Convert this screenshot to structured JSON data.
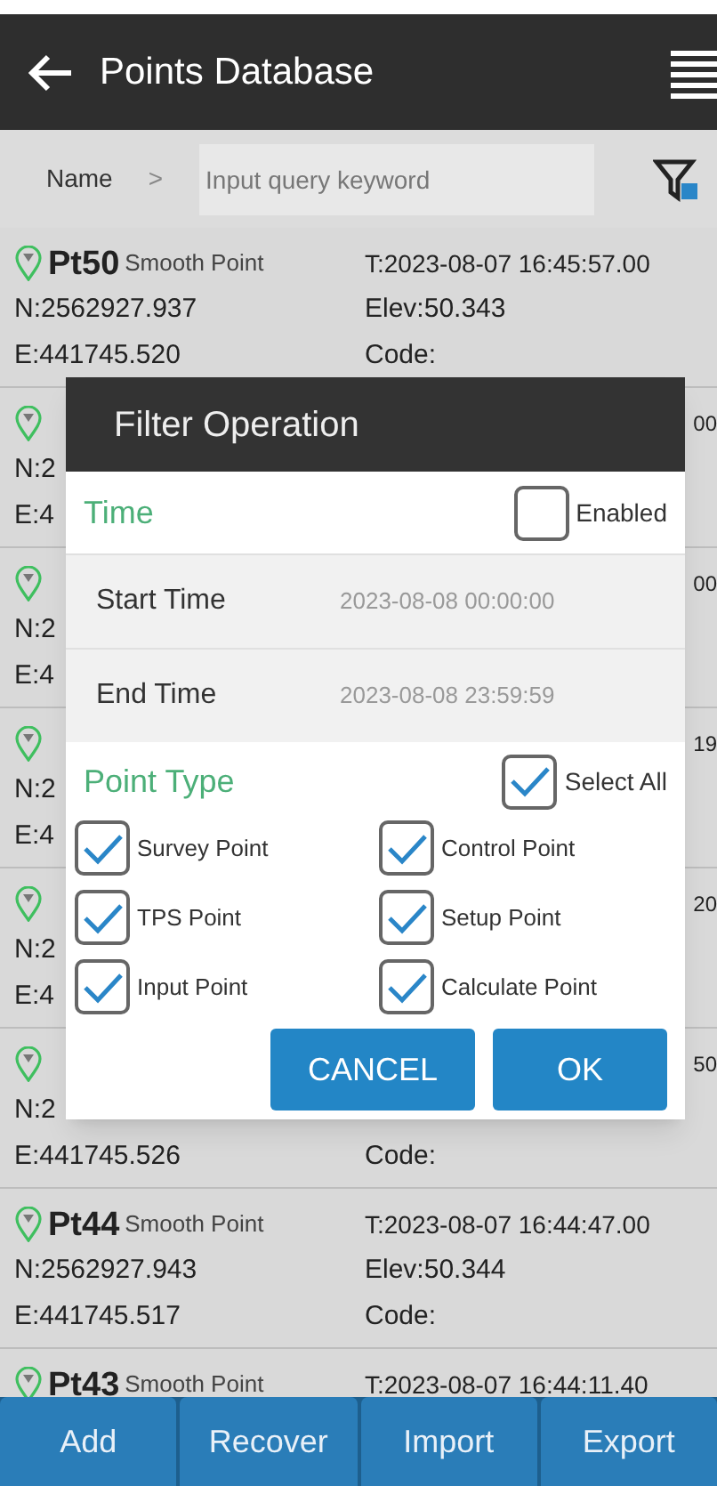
{
  "header": {
    "title": "Points Database"
  },
  "search": {
    "field_label": "Name",
    "separator": ">",
    "placeholder": "Input query keyword"
  },
  "points": [
    {
      "kind": "full",
      "name": "Pt50",
      "type": "Smooth Point",
      "t": "T:2023-08-07 16:45:57.00",
      "n": "N:2562927.937",
      "elev": "Elev:50.343",
      "e": "E:441745.520",
      "code": "Code:"
    },
    {
      "kind": "covered",
      "t": "00",
      "n": "N:2",
      "e": "E:4"
    },
    {
      "kind": "covered",
      "t": "00",
      "n": "N:2",
      "e": "E:4"
    },
    {
      "kind": "covered",
      "t": "19",
      "n": "N:2",
      "e": "E:4"
    },
    {
      "kind": "covered",
      "t": "20",
      "n": "N:2",
      "e": "E:4"
    },
    {
      "kind": "covered",
      "t": "50",
      "n": "N:2",
      "e": "E:441745.526",
      "code": "Code:"
    },
    {
      "kind": "full",
      "name": "Pt44",
      "type": "Smooth Point",
      "t": "T:2023-08-07 16:44:47.00",
      "n": "N:2562927.943",
      "elev": "Elev:50.344",
      "e": "E:441745.517",
      "code": "Code:"
    },
    {
      "kind": "full",
      "name": "Pt43",
      "type": "Smooth Point",
      "t": "T:2023-08-07 16:44:11.40"
    }
  ],
  "dialog": {
    "title": "Filter Operation",
    "time": {
      "label": "Time",
      "toggle_label": "Enabled",
      "checked": false,
      "rows": [
        {
          "label": "Start Time",
          "value": "2023-08-08 00:00:00"
        },
        {
          "label": "End Time",
          "value": "2023-08-08 23:59:59"
        }
      ]
    },
    "point_type": {
      "label": "Point Type",
      "toggle_label": "Select All",
      "checked": true,
      "options": [
        {
          "label": "Survey Point",
          "checked": true
        },
        {
          "label": "Control Point",
          "checked": true
        },
        {
          "label": "TPS Point",
          "checked": true
        },
        {
          "label": "Setup Point",
          "checked": true
        },
        {
          "label": "Input Point",
          "checked": true
        },
        {
          "label": "Calculate Point",
          "checked": true
        }
      ]
    },
    "buttons": [
      "CANCEL",
      "OK"
    ]
  },
  "bottom_bar": [
    "Add",
    "Recover",
    "Import",
    "Export"
  ]
}
